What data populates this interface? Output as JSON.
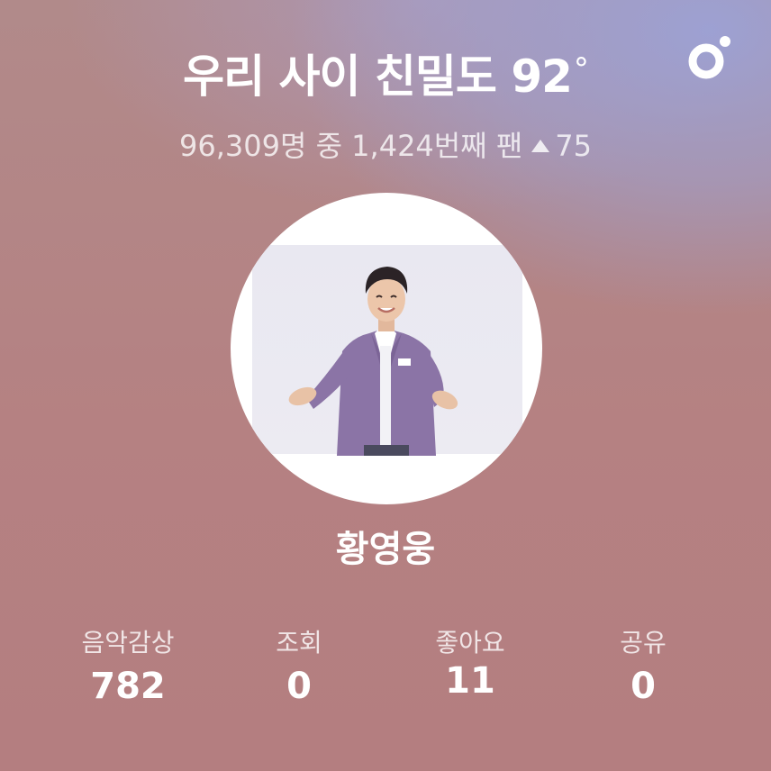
{
  "header": {
    "title": "우리 사이 친밀도 92",
    "degree_symbol": "°",
    "subtitle": "96,309명 중 1,424번째 팬",
    "rank_change": "75"
  },
  "artist": {
    "name": "황영웅"
  },
  "stats": [
    {
      "label": "음악감상",
      "value": "782"
    },
    {
      "label": "조회",
      "value": "0"
    },
    {
      "label": "좋아요",
      "value": "11"
    },
    {
      "label": "공유",
      "value": "0"
    }
  ],
  "icons": {
    "logo": "app-logo-icon",
    "rank_up": "triangle-up-icon"
  },
  "colors": {
    "text": "#ffffff",
    "background_top": "#9ca2d6",
    "background_bottom": "#b47e80"
  }
}
